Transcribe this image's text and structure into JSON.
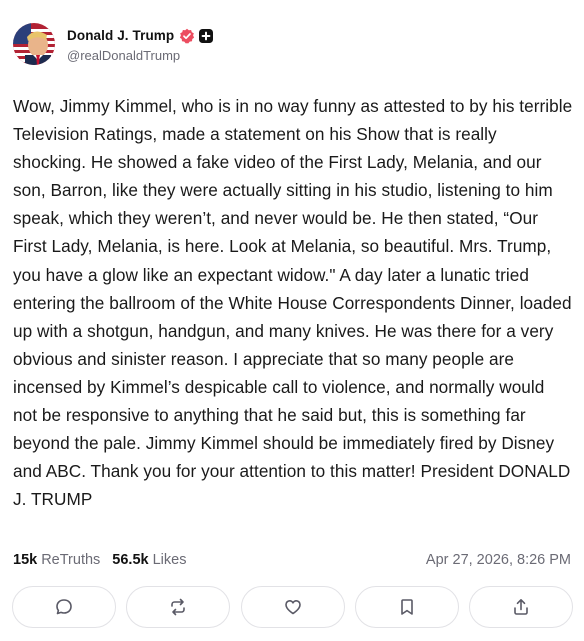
{
  "author": {
    "display_name": "Donald J. Trump",
    "handle": "@realDonaldTrump",
    "avatar_icon": "avatar-portrait",
    "verified_icon": "verified-badge-icon",
    "verified_color": "#ec4d60",
    "plus_icon": "plus-badge-icon"
  },
  "post": {
    "text": "Wow, Jimmy Kimmel, who is in no way funny as attested to by his terrible Television Ratings, made a statement on his Show that is really shocking. He showed a fake video of the First Lady, Melania, and our son, Barron, like they were actually sitting in his studio, listening to him speak, which they weren’t, and never would be. He then stated, “Our First Lady, Melania, is here. Look at Melania, so beautiful. Mrs. Trump, you have a glow like an expectant widow.\" A day later a lunatic tried entering the ballroom of the White House Correspondents Dinner, loaded up with a shotgun, handgun, and many knives. He was there for a very obvious and sinister reason. I appreciate that so many people are incensed by Kimmel’s despicable call to violence, and normally would not be responsive to anything that he said but, this is something far beyond the pale. Jimmy Kimmel should be immediately fired by Disney and ABC. Thank you for your attention to this matter! President DONALD J. TRUMP"
  },
  "stats": {
    "retruths_count": "15k",
    "retruths_label": "ReTruths",
    "likes_count": "56.5k",
    "likes_label": "Likes",
    "timestamp": "Apr 27, 2026, 8:26 PM"
  },
  "actions": [
    {
      "name": "reply",
      "icon": "comment-icon"
    },
    {
      "name": "retruth",
      "icon": "repost-icon"
    },
    {
      "name": "like",
      "icon": "heart-icon"
    },
    {
      "name": "bookmark",
      "icon": "bookmark-icon"
    },
    {
      "name": "share",
      "icon": "share-icon"
    }
  ],
  "colors": {
    "text": "#1a1a1a",
    "muted": "#6b6b75",
    "border": "#e2e2e6",
    "icon": "#5a5a66"
  }
}
